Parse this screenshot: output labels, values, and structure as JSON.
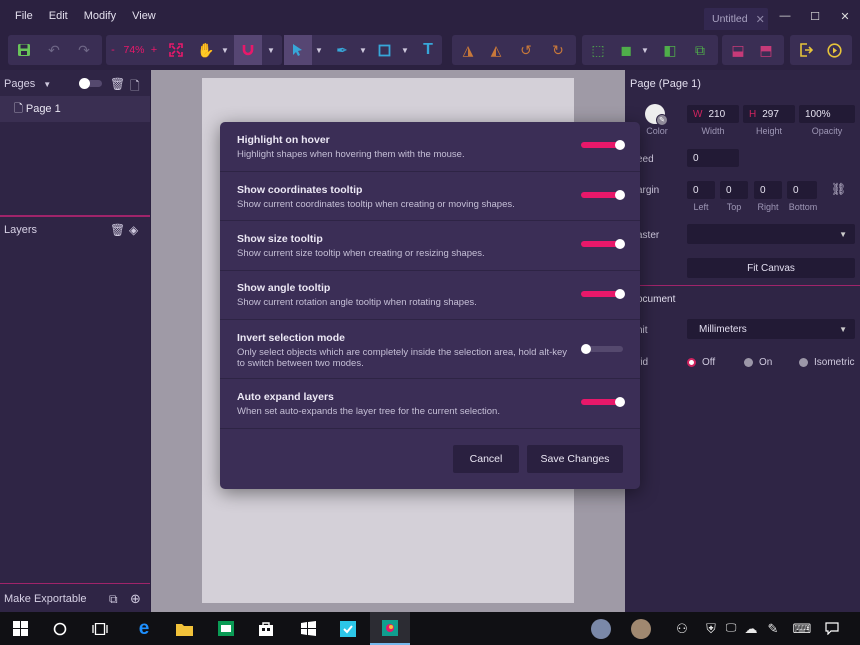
{
  "menu": [
    "File",
    "Edit",
    "Modify",
    "View"
  ],
  "doc_tab": {
    "title": "Untitled",
    "close": "✕"
  },
  "window_controls": {
    "minimize": "—",
    "maximize": "☐",
    "close": "✕"
  },
  "toolbar": {
    "zoom": "74%",
    "zoom_minus": "-",
    "zoom_plus": "+",
    "text_tool": "T"
  },
  "left_panel": {
    "pages_header": "Pages",
    "pages": [
      "Page 1"
    ],
    "layers_header": "Layers",
    "make_exportable": "Make Exportable"
  },
  "right_panel": {
    "title": "Page (Page 1)",
    "color_label": "Color",
    "width": {
      "prefix": "W",
      "value": "210",
      "label": "Width"
    },
    "height": {
      "prefix": "H",
      "value": "297",
      "label": "Height"
    },
    "opacity": {
      "value": "100%",
      "label": "Opacity"
    },
    "bleed": {
      "label": "eed",
      "value": "0"
    },
    "margin": {
      "label": "argin",
      "left": "0",
      "top": "0",
      "right": "0",
      "bottom": "0",
      "left_label": "Left",
      "top_label": "Top",
      "right_label": "Right",
      "bottom_label": "Bottom"
    },
    "master_label": "aster",
    "fit_canvas": "Fit Canvas",
    "document_header": "ocument",
    "unit": {
      "label": "nit",
      "value": "Millimeters"
    },
    "grid": {
      "label": "rid",
      "options": [
        "Off",
        "On",
        "Isometric"
      ],
      "selected": "Off"
    }
  },
  "modal": {
    "settings": [
      {
        "title": "Highlight on hover",
        "desc": "Highlight shapes when hovering them with the mouse.",
        "on": true
      },
      {
        "title": "Show coordinates tooltip",
        "desc": "Show current coordinates tooltip when creating or moving shapes.",
        "on": true
      },
      {
        "title": "Show size tooltip",
        "desc": "Show current size tooltip when creating or resizing shapes.",
        "on": true
      },
      {
        "title": "Show angle tooltip",
        "desc": "Show current rotation angle tooltip when rotating shapes.",
        "on": true
      },
      {
        "title": "Invert selection mode",
        "desc": "Only select objects which are completely inside the selection area, hold alt-key to switch between two modes.",
        "on": false
      },
      {
        "title": "Auto expand layers",
        "desc": "When set auto-expands the layer tree for the current selection.",
        "on": true
      }
    ],
    "cancel": "Cancel",
    "save": "Save Changes"
  },
  "colors": {
    "accent": "#e8186a",
    "panel": "#2f2545",
    "modal": "#3b2e56"
  }
}
